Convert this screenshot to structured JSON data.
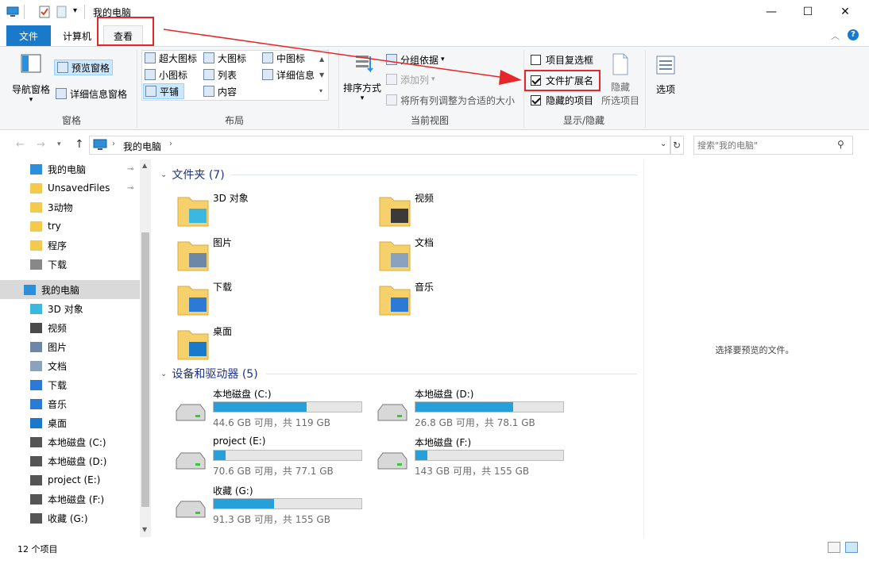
{
  "title_bar": {
    "title": "我的电脑",
    "minimize": "—",
    "maximize": "☐",
    "close": "✕"
  },
  "ribbon_tabs": {
    "file": "文件",
    "computer": "计算机",
    "view": "查看"
  },
  "ribbon": {
    "pane_group": {
      "nav_pane": "导航窗格",
      "preview_pane": "预览窗格",
      "details_pane": "详细信息窗格",
      "label": "窗格"
    },
    "layout_group": {
      "extra_large": "超大图标",
      "large": "大图标",
      "medium": "中图标",
      "small": "小图标",
      "list": "列表",
      "details": "详细信息",
      "tiles": "平铺",
      "content": "内容",
      "label": "布局"
    },
    "current_view_group": {
      "sort": "排序方式",
      "group_by": "分组依据",
      "add_column": "添加列",
      "fit_columns": "将所有列调整为合适的大小",
      "label": "当前视图"
    },
    "show_hide_group": {
      "item_checkboxes": "项目复选框",
      "file_extensions": "文件扩展名",
      "hidden_items": "隐藏的项目",
      "hide_selected_1": "隐藏",
      "hide_selected_2": "所选项目",
      "label": "显示/隐藏"
    },
    "options": "选项",
    "checkbox_states": {
      "item_checkboxes": false,
      "file_extensions": true,
      "hidden_items": true
    }
  },
  "address": {
    "path": "我的电脑",
    "search_placeholder": "搜索\"我的电脑\""
  },
  "nav_pane": {
    "quick_access": [
      "我的电脑",
      "UnsavedFiles",
      "3动物",
      "try",
      "程序",
      "下载"
    ],
    "this_pc": "我的电脑",
    "this_pc_children": [
      "3D 对象",
      "视频",
      "图片",
      "文档",
      "下载",
      "音乐",
      "桌面",
      "本地磁盘 (C:)",
      "本地磁盘 (D:)",
      "project (E:)",
      "本地磁盘 (F:)",
      "收藏 (G:)"
    ]
  },
  "content": {
    "folders_header": "文件夹 (7)",
    "folders": [
      "3D 对象",
      "视频",
      "图片",
      "文档",
      "下载",
      "音乐",
      "桌面"
    ],
    "drives_header": "设备和驱动器 (5)",
    "drives": [
      {
        "name": "本地磁盘 (C:)",
        "size": "44.6 GB 可用，共 119 GB",
        "used_fraction": 0.63
      },
      {
        "name": "本地磁盘 (D:)",
        "size": "26.8 GB 可用，共 78.1 GB",
        "used_fraction": 0.66
      },
      {
        "name": "project (E:)",
        "size": "70.6 GB 可用，共 77.1 GB",
        "used_fraction": 0.08
      },
      {
        "name": "本地磁盘 (F:)",
        "size": "143 GB 可用，共 155 GB",
        "used_fraction": 0.08
      },
      {
        "name": "收藏 (G:)",
        "size": "91.3 GB 可用，共 155 GB",
        "used_fraction": 0.41
      }
    ]
  },
  "preview": {
    "empty_text": "选择要预览的文件。"
  },
  "status": {
    "count": "12 个项目"
  },
  "colors": {
    "accent": "#1979ca",
    "drive_bar": "#26a0da",
    "annotation": "#e5262a"
  }
}
